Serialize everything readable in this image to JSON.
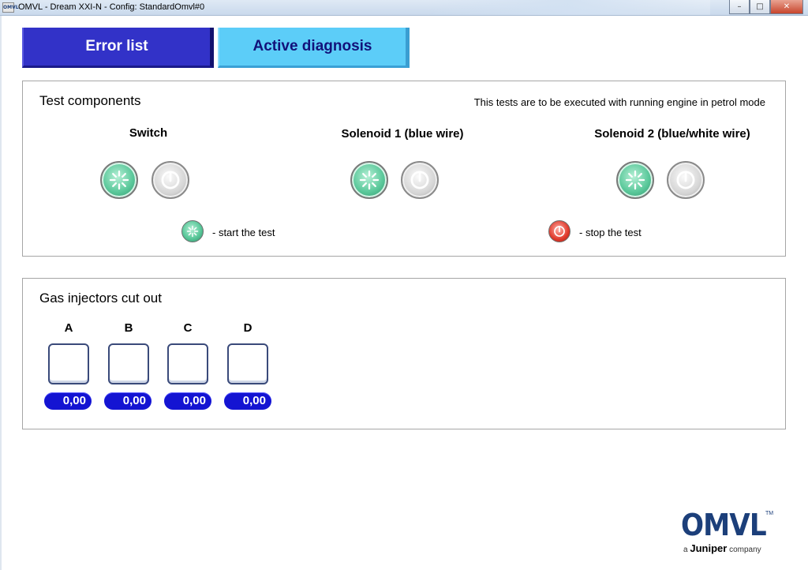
{
  "window": {
    "title": "OMVL - Dream XXI-N - Config: StandardOmvl#0",
    "app_icon_text": "OMVL",
    "controls": {
      "minimize": "–",
      "maximize": "□",
      "close": "✕"
    }
  },
  "tabs": [
    {
      "label": "Error list",
      "active": true
    },
    {
      "label": "Active diagnosis",
      "active": false
    }
  ],
  "test_components": {
    "title": "Test components",
    "note": "This tests are to be executed with running engine in petrol mode",
    "components": [
      {
        "label": "Switch",
        "start_icon": "start-test-icon",
        "stop_icon": "stop-test-icon"
      },
      {
        "label": "Solenoid 1 (blue wire)",
        "start_icon": "start-test-icon",
        "stop_icon": "stop-test-icon"
      },
      {
        "label": "Solenoid 2 (blue/white wire)",
        "start_icon": "start-test-icon",
        "stop_icon": "stop-test-icon"
      }
    ],
    "legend": {
      "start": "- start the test",
      "stop": "- stop the test"
    }
  },
  "gas_injectors": {
    "title": "Gas injectors cut out",
    "injectors": [
      {
        "label": "A",
        "value": "0,00"
      },
      {
        "label": "B",
        "value": "0,00"
      },
      {
        "label": "C",
        "value": "0,00"
      },
      {
        "label": "D",
        "value": "0,00"
      }
    ]
  },
  "logo": {
    "word": "OMVL",
    "tm": "TM",
    "sub_prefix": "a",
    "sub_brand": "Juniper",
    "sub_suffix": "company"
  },
  "colors": {
    "tab_active": "#3232c8",
    "tab_inactive": "#5ccdf8",
    "value_pill": "#1414d2",
    "brand": "#1c3f7a"
  }
}
